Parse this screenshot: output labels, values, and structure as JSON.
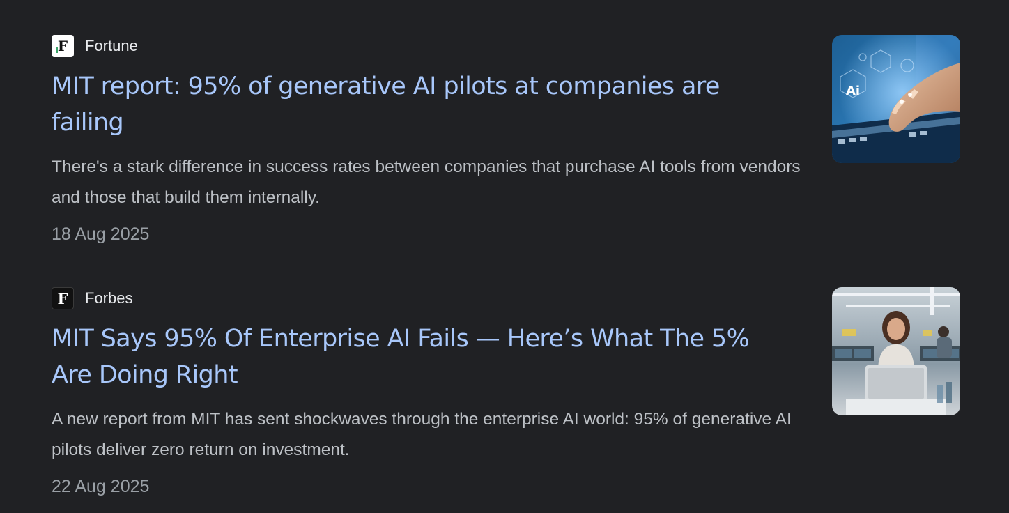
{
  "articles": [
    {
      "source": "Fortune",
      "favicon_icon": "fortune-logo-icon",
      "favicon_letter": "F",
      "headline": "MIT report: 95% of generative AI pilots at companies are failing",
      "snippet": "There's a stark difference in success rates between companies that purchase AI tools from vendors and those that build them internally.",
      "date": "18 Aug 2025",
      "thumbnail_icon": "ai-hand-thumbnail",
      "thumbnail_text": "Ai"
    },
    {
      "source": "Forbes",
      "favicon_icon": "forbes-logo-icon",
      "favicon_letter": "F",
      "headline": "MIT Says 95% Of Enterprise AI Fails — Here’s What The 5% Are Doing Right",
      "snippet": "A new report from MIT has sent shockwaves through the enterprise AI world: 95% of generative AI pilots deliver zero return on investment.",
      "date": "22 Aug 2025",
      "thumbnail_icon": "office-laptop-thumbnail"
    }
  ],
  "colors": {
    "background": "#202124",
    "headline": "#a8c7fa",
    "snippet": "#bdc1c6",
    "date": "#9aa0a6",
    "source": "#e8eaed"
  }
}
